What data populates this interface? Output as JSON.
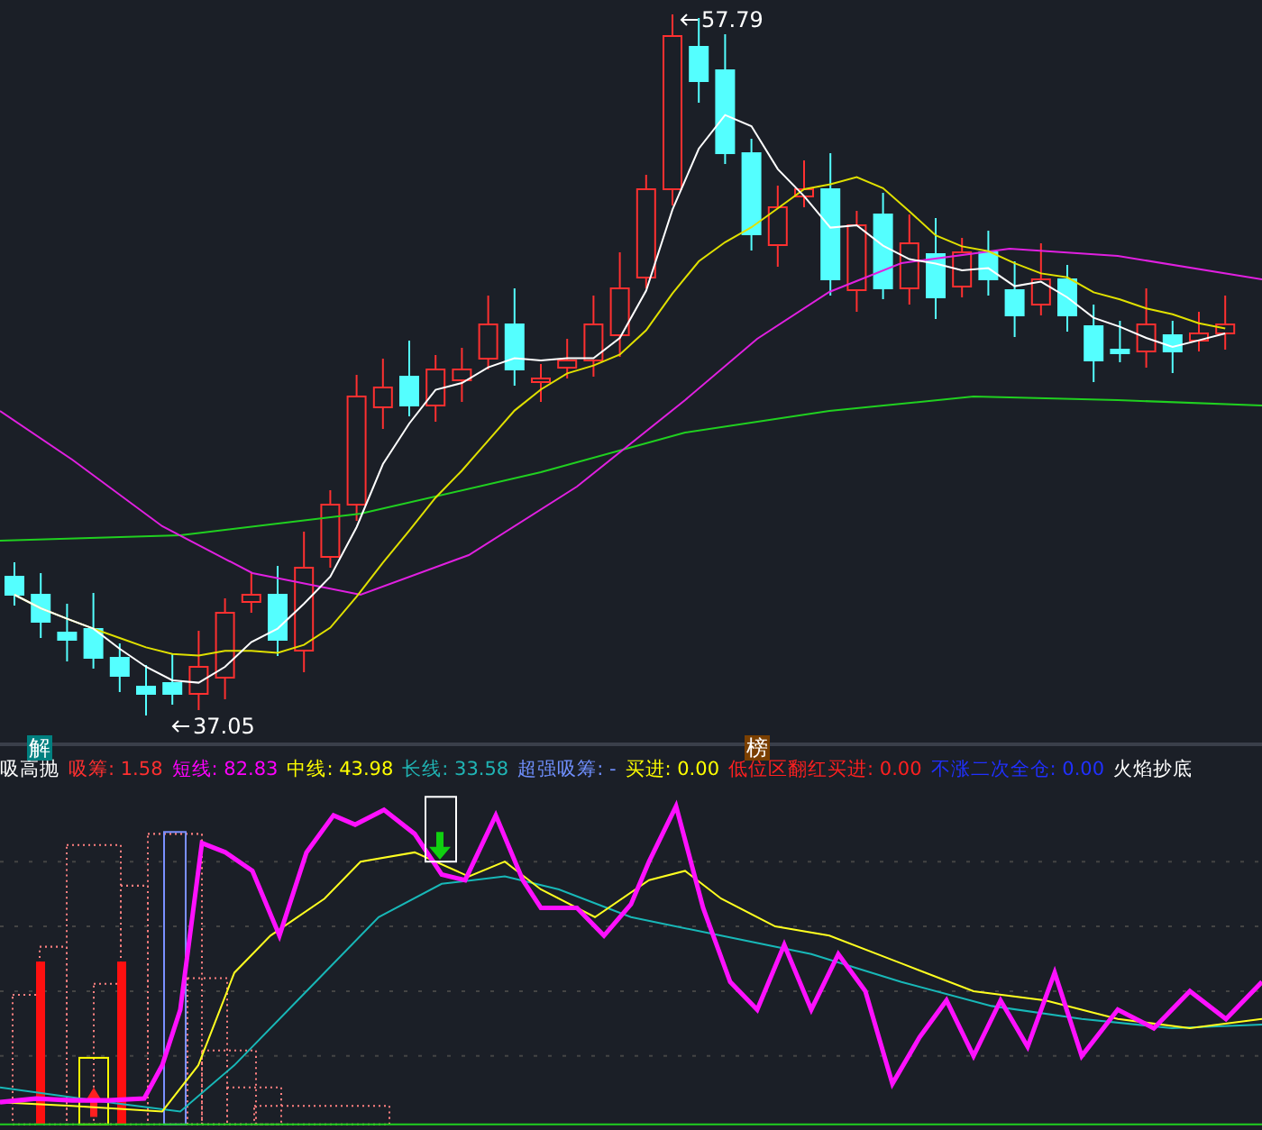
{
  "price_chart": {
    "high_label": "57.79",
    "low_label": "37.05",
    "markers": [
      {
        "text": "解",
        "color": "#008080"
      },
      {
        "text": "榜",
        "color": "#7a3f00"
      }
    ]
  },
  "indicator": {
    "title": "吸高抛",
    "items": [
      {
        "label": "吸筹:",
        "value": "1.58",
        "color": "#ff3030"
      },
      {
        "label": "短线:",
        "value": "82.83",
        "color": "#ff00ff"
      },
      {
        "label": "中线:",
        "value": "43.98",
        "color": "#ffff00"
      },
      {
        "label": "长线:",
        "value": "33.58",
        "color": "#20b4b4"
      },
      {
        "label": "超强吸筹:",
        "value": "-",
        "color": "#7090ff"
      },
      {
        "label": "买进:",
        "value": "0.00",
        "color": "#ffff00"
      },
      {
        "label": "低位区翻红买进:",
        "value": "0.00",
        "color": "#ff2020"
      },
      {
        "label": "不涨二次全仓:",
        "value": "0.00",
        "color": "#2030ff"
      },
      {
        "label": "火焰抄底",
        "color": "#ffffff"
      }
    ]
  }
}
